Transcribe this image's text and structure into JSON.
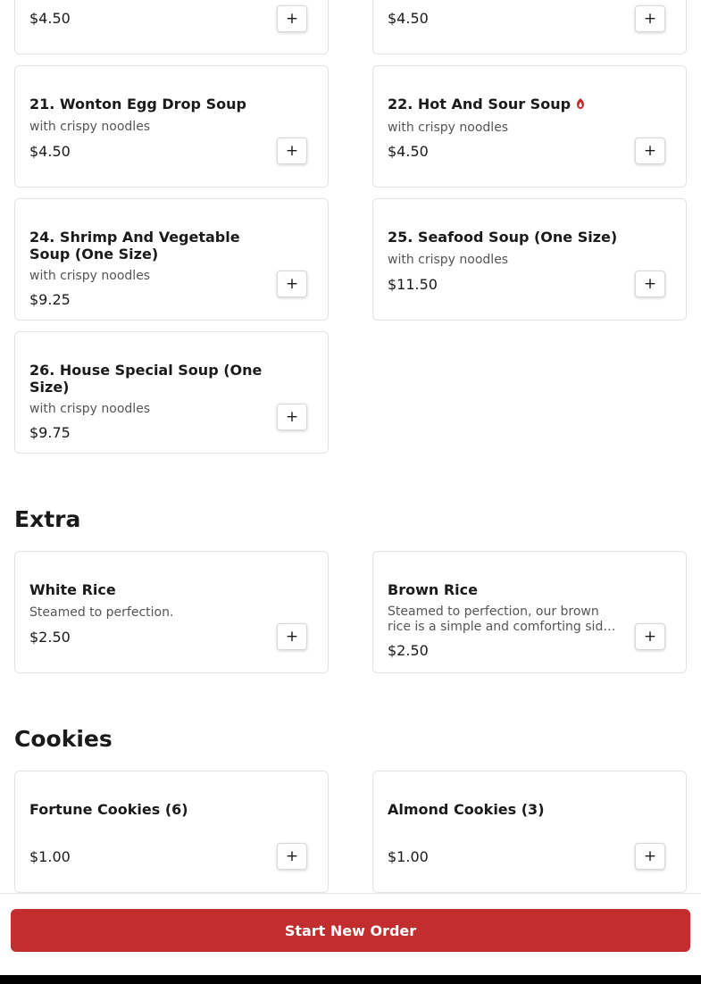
{
  "menu": {
    "soup_items": [
      {
        "name": "",
        "desc": "",
        "price": "$4.50"
      },
      {
        "name": "",
        "desc": "",
        "price": "$4.50"
      },
      {
        "name": "21. Wonton Egg Drop Soup",
        "desc": "with crispy noodles",
        "price": "$4.50"
      },
      {
        "name": "22. Hot And Sour Soup",
        "desc": "with crispy noodles",
        "price": "$4.50",
        "spicy_icon": "chili-pepper-icon"
      },
      {
        "name": "24. Shrimp And Vegetable Soup (One Size)",
        "desc": "with crispy noodles",
        "price": "$9.25"
      },
      {
        "name": "25. Seafood Soup (One Size)",
        "desc": "with crispy noodles",
        "price": "$11.50"
      },
      {
        "name": "26. House Special Soup (One Size)",
        "desc": "with crispy noodles",
        "price": "$9.75"
      }
    ],
    "extra": {
      "title": "Extra",
      "items": [
        {
          "name": "White Rice",
          "desc": "Steamed to perfection.",
          "price": "$2.50"
        },
        {
          "name": "Brown Rice",
          "desc": "Steamed to perfection, our brown rice is a simple and comforting side dish.",
          "price": "$2.50"
        }
      ]
    },
    "cookies": {
      "title": "Cookies",
      "items": [
        {
          "name": "Fortune Cookies (6)",
          "price": "$1.00"
        },
        {
          "name": "Almond Cookies (3)",
          "price": "$1.00"
        }
      ]
    },
    "add_label": "+"
  },
  "footer": {
    "order_button_label": "Start New Order"
  },
  "colors": {
    "accent": "#c22e2e",
    "spicy": "#c62828"
  }
}
